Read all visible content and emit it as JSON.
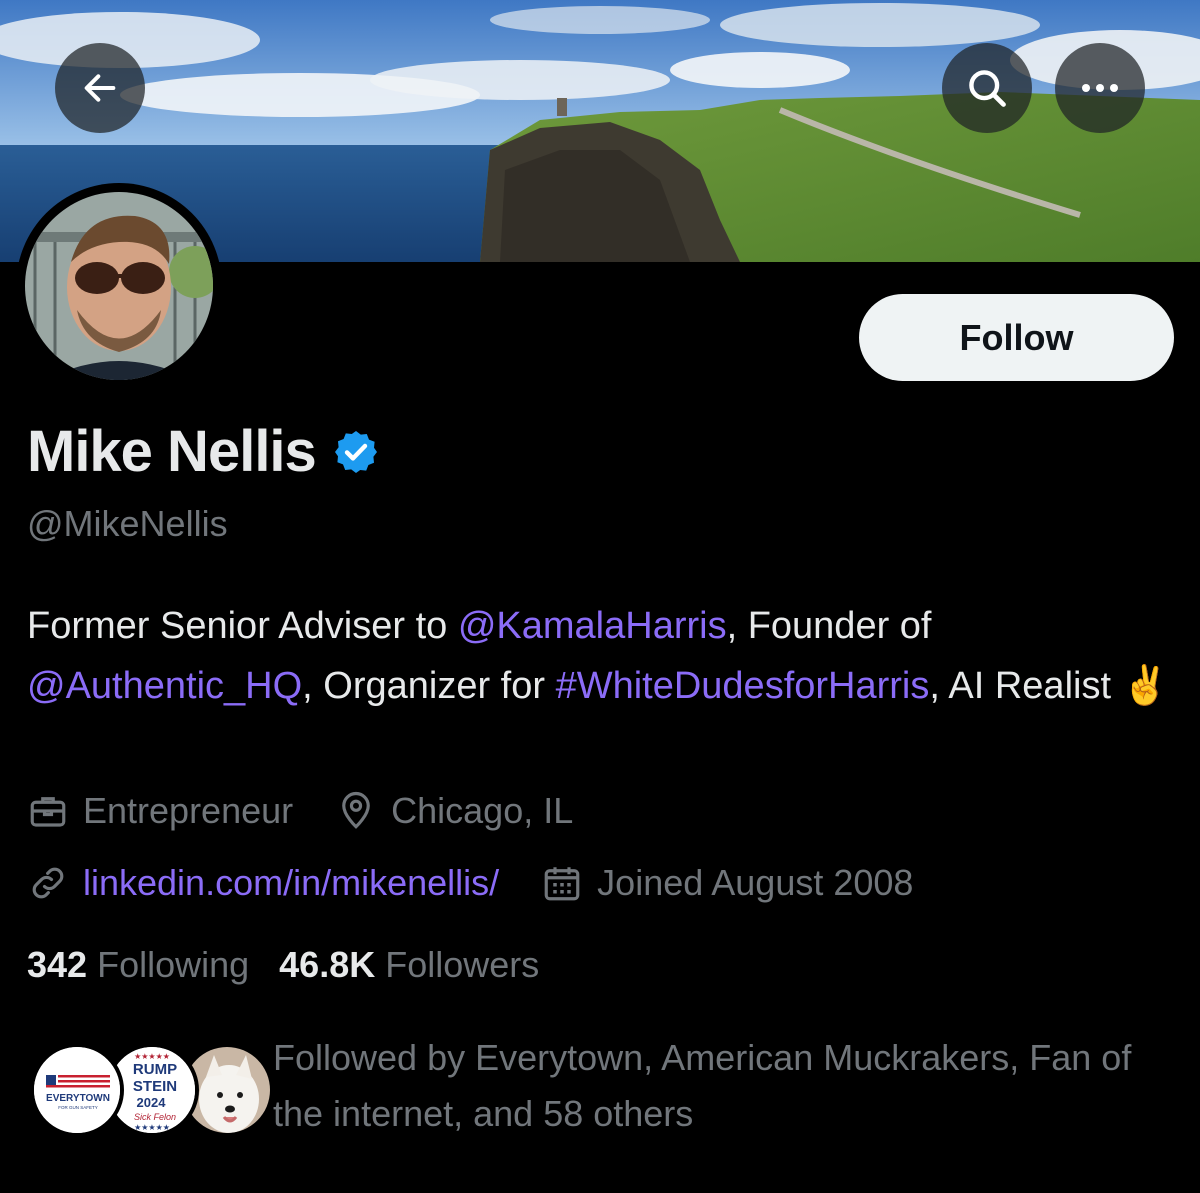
{
  "header": {
    "back_icon": "arrow-left-icon",
    "search_icon": "search-icon",
    "more_icon": "more-horizontal-icon"
  },
  "profile": {
    "name": "Mike Nellis",
    "handle": "@MikeNellis",
    "follow_label": "Follow",
    "bio": {
      "p1": "Former Senior Adviser to ",
      "mention1": "@KamalaHarris",
      "p2": ", Founder of ",
      "mention2": "@Authentic_HQ",
      "p3": ", Organizer for ",
      "hashtag": "#WhiteDudesforHarris",
      "p4": ", AI Realist ",
      "emoji": "✌️"
    },
    "profession": "Entrepreneur",
    "location": "Chicago, IL",
    "website": "linkedin.com/in/mikenellis/",
    "joined": "Joined August 2008",
    "following_count": "342",
    "following_label": "Following",
    "followers_count": "46.8K",
    "followers_label": "Followers",
    "followed_by": "Followed by Everytown, American Muckrakers, Fan of the internet, and 58 others"
  },
  "known_followers": {
    "everytown_logo": "EVERYTOWN",
    "everytown_tagline": "FOR GUN SAFETY",
    "sign_line1": "RUMP",
    "sign_line2": "STEIN",
    "sign_line3": "2024",
    "sign_line4": "Sick Felon"
  },
  "colors": {
    "accent_link": "#8b6cf7",
    "verified": "#1d9bf0",
    "muted_text": "#71767b",
    "primary_text": "#e7e9ea",
    "background": "#000000"
  }
}
